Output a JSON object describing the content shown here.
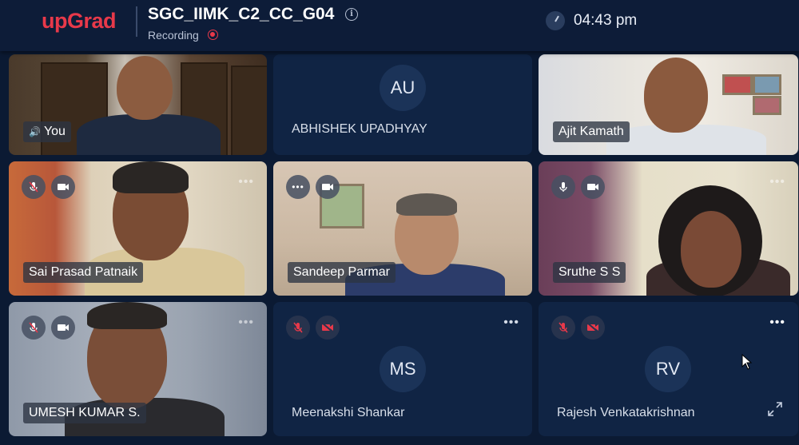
{
  "header": {
    "logo": "upGrad",
    "meeting_title": "SGC_IIMK_C2_CC_G04",
    "recording_label": "Recording",
    "time": "04:43 pm"
  },
  "participants": [
    {
      "name": "You",
      "type": "video"
    },
    {
      "name": "ABHISHEK UPADHYAY",
      "initials": "AU",
      "type": "avatar"
    },
    {
      "name": "Ajit Kamath",
      "type": "video"
    },
    {
      "name": "Sai Prasad Patnaik",
      "type": "video"
    },
    {
      "name": "Sandeep Parmar",
      "type": "video"
    },
    {
      "name": "Sruthe S S",
      "type": "video"
    },
    {
      "name": "UMESH KUMAR S.",
      "type": "video"
    },
    {
      "name": "Meenakshi Shankar",
      "initials": "MS",
      "type": "avatar"
    },
    {
      "name": "Rajesh Venkatakrishnan",
      "initials": "RV",
      "type": "avatar"
    }
  ],
  "more_glyph": "•••",
  "colors": {
    "brand": "#e8394a",
    "background": "#0b1a33",
    "tile": "#102444"
  }
}
